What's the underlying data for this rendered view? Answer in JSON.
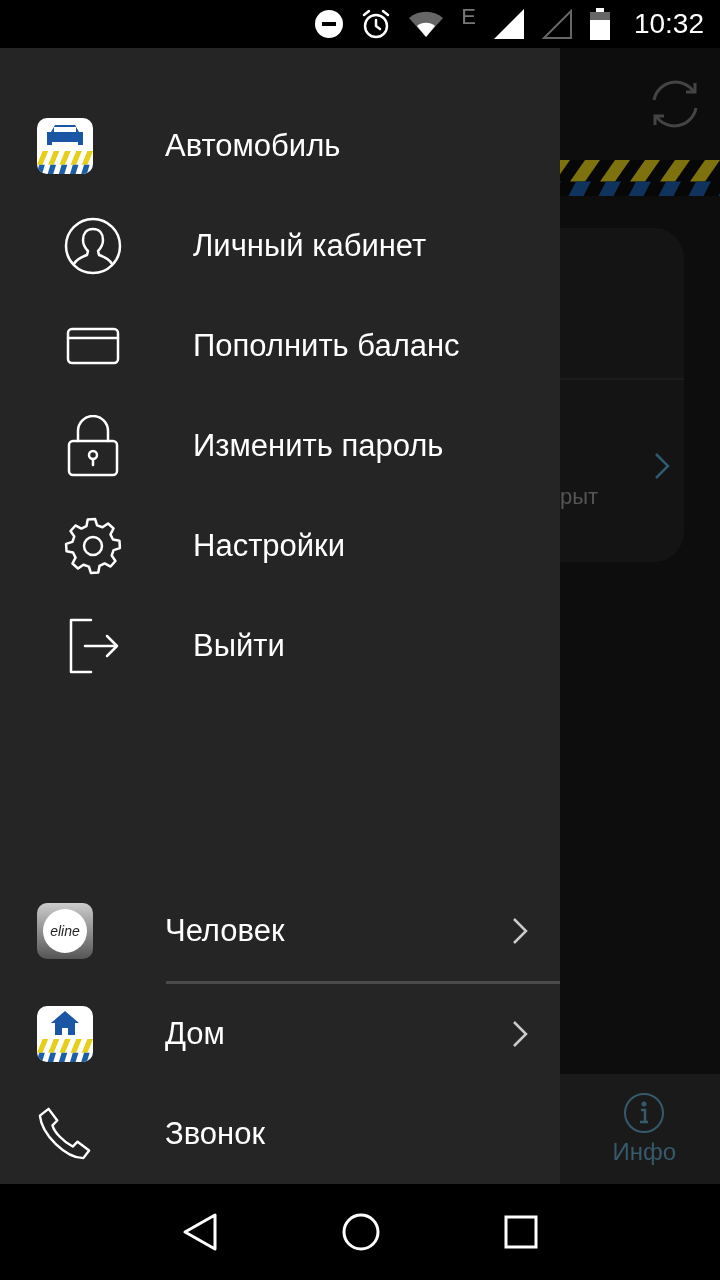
{
  "status_bar": {
    "network": "E",
    "time": "10:32"
  },
  "background": {
    "card_label": "рыт",
    "tab": {
      "label": "Инфо"
    }
  },
  "drawer": {
    "header": {
      "label": "Автомобиль",
      "kind": "car"
    },
    "items": [
      {
        "kind": "user",
        "label": "Личный кабинет"
      },
      {
        "kind": "card",
        "label": "Пополнить баланс"
      },
      {
        "kind": "lock",
        "label": "Изменить пароль"
      },
      {
        "kind": "gear",
        "label": "Настройки"
      },
      {
        "kind": "logout",
        "label": "Выйти"
      }
    ],
    "apps": [
      {
        "kind": "eline",
        "logo_text": "eline",
        "label": "Человек",
        "has_chevron": true
      },
      {
        "kind": "house",
        "label": "Дом",
        "has_chevron": true
      },
      {
        "kind": "phone",
        "label": "Звонок",
        "has_chevron": false
      }
    ]
  }
}
